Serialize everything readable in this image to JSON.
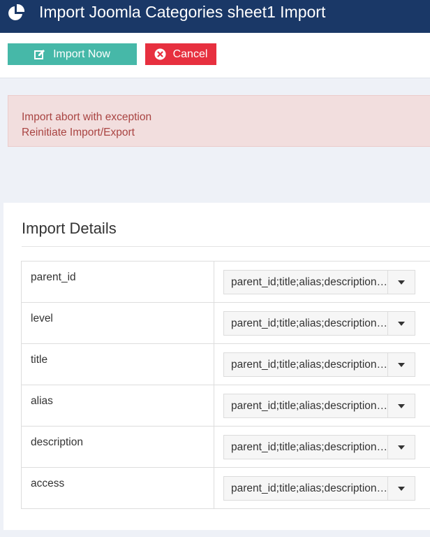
{
  "header": {
    "title": "Import Joomla Categories sheet1 Import",
    "background": "#1a3867"
  },
  "toolbar": {
    "import_label": "Import Now",
    "cancel_label": "Cancel",
    "import_color": "#46b8a8",
    "cancel_color": "#e7303f"
  },
  "alert": {
    "line1": "Import abort with exception",
    "line2": "Reinitiate Import/Export"
  },
  "details": {
    "title": "Import Details",
    "rows": [
      {
        "field": "parent_id",
        "value": "parent_id;title;alias;description;published;access;"
      },
      {
        "field": "level",
        "value": "parent_id;title;alias;description;published;access;"
      },
      {
        "field": "title",
        "value": "parent_id;title;alias;description;published;access;"
      },
      {
        "field": "alias",
        "value": "parent_id;title;alias;description;published;access;"
      },
      {
        "field": "description",
        "value": "parent_id;title;alias;description;published;access;"
      },
      {
        "field": "access",
        "value": "parent_id;title;alias;description;published;access;"
      }
    ]
  }
}
